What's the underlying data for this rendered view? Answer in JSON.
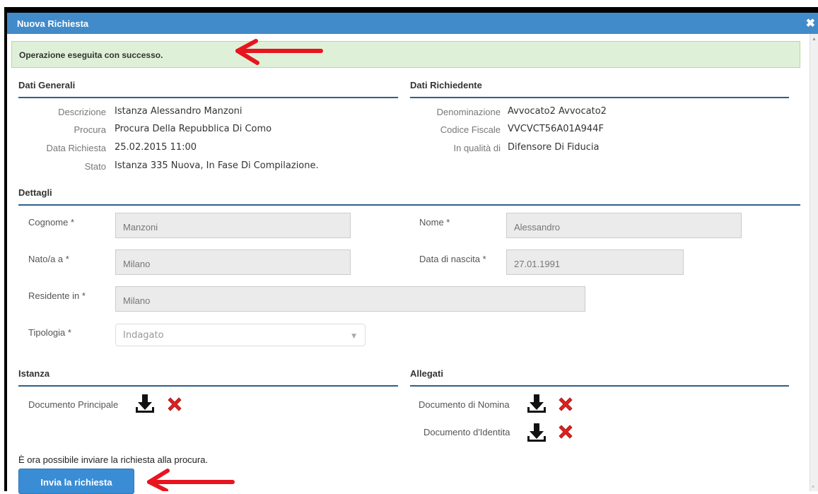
{
  "dialog": {
    "title": "Nuova Richiesta",
    "close_symbol": "✖"
  },
  "alert": {
    "message": "Operazione eseguita con successo."
  },
  "dati_generali": {
    "title": "Dati Generali",
    "rows": [
      {
        "label": "Descrizione",
        "value": "Istanza Alessandro Manzoni"
      },
      {
        "label": "Procura",
        "value": "Procura Della Repubblica Di Como"
      },
      {
        "label": "Data Richiesta",
        "value": "25.02.2015 11:00"
      },
      {
        "label": "Stato",
        "value": "Istanza 335 Nuova, In Fase Di Compilazione."
      }
    ]
  },
  "dati_richiedente": {
    "title": "Dati Richiedente",
    "rows": [
      {
        "label": "Denominazione",
        "value": "Avvocato2 Avvocato2"
      },
      {
        "label": "Codice Fiscale",
        "value": "VVCVCT56A01A944F"
      },
      {
        "label": "In qualità di",
        "value": "Difensore Di Fiducia"
      }
    ]
  },
  "dettagli": {
    "title": "Dettagli",
    "cognome": {
      "label": "Cognome *",
      "value": "Manzoni"
    },
    "nome": {
      "label": "Nome *",
      "value": "Alessandro"
    },
    "nato": {
      "label": "Nato/a a *",
      "value": "Milano"
    },
    "data_nascita": {
      "label": "Data di nascita *",
      "value": "27.01.1991"
    },
    "residente": {
      "label": "Residente in *",
      "value": "Milano"
    },
    "tipologia": {
      "label": "Tipologia *",
      "value": "Indagato"
    }
  },
  "istanza": {
    "title": "Istanza",
    "doc_principale": "Documento Principale"
  },
  "allegati": {
    "title": "Allegati",
    "doc_nomina": "Documento di Nomina",
    "doc_identita": "Documento d'Identita"
  },
  "footer": {
    "info": "È ora possibile inviare la richiesta alla procura.",
    "submit_label": "Invia la richiesta"
  },
  "colors": {
    "header_blue": "#428bca",
    "success_bg": "#dff0d8",
    "divider": "#2f5f8a",
    "delete_red": "#e02020",
    "annotation_arrow": "#e8141e"
  },
  "icons": [
    "close-icon",
    "download-icon",
    "delete-icon",
    "red-arrow-annotation"
  ]
}
